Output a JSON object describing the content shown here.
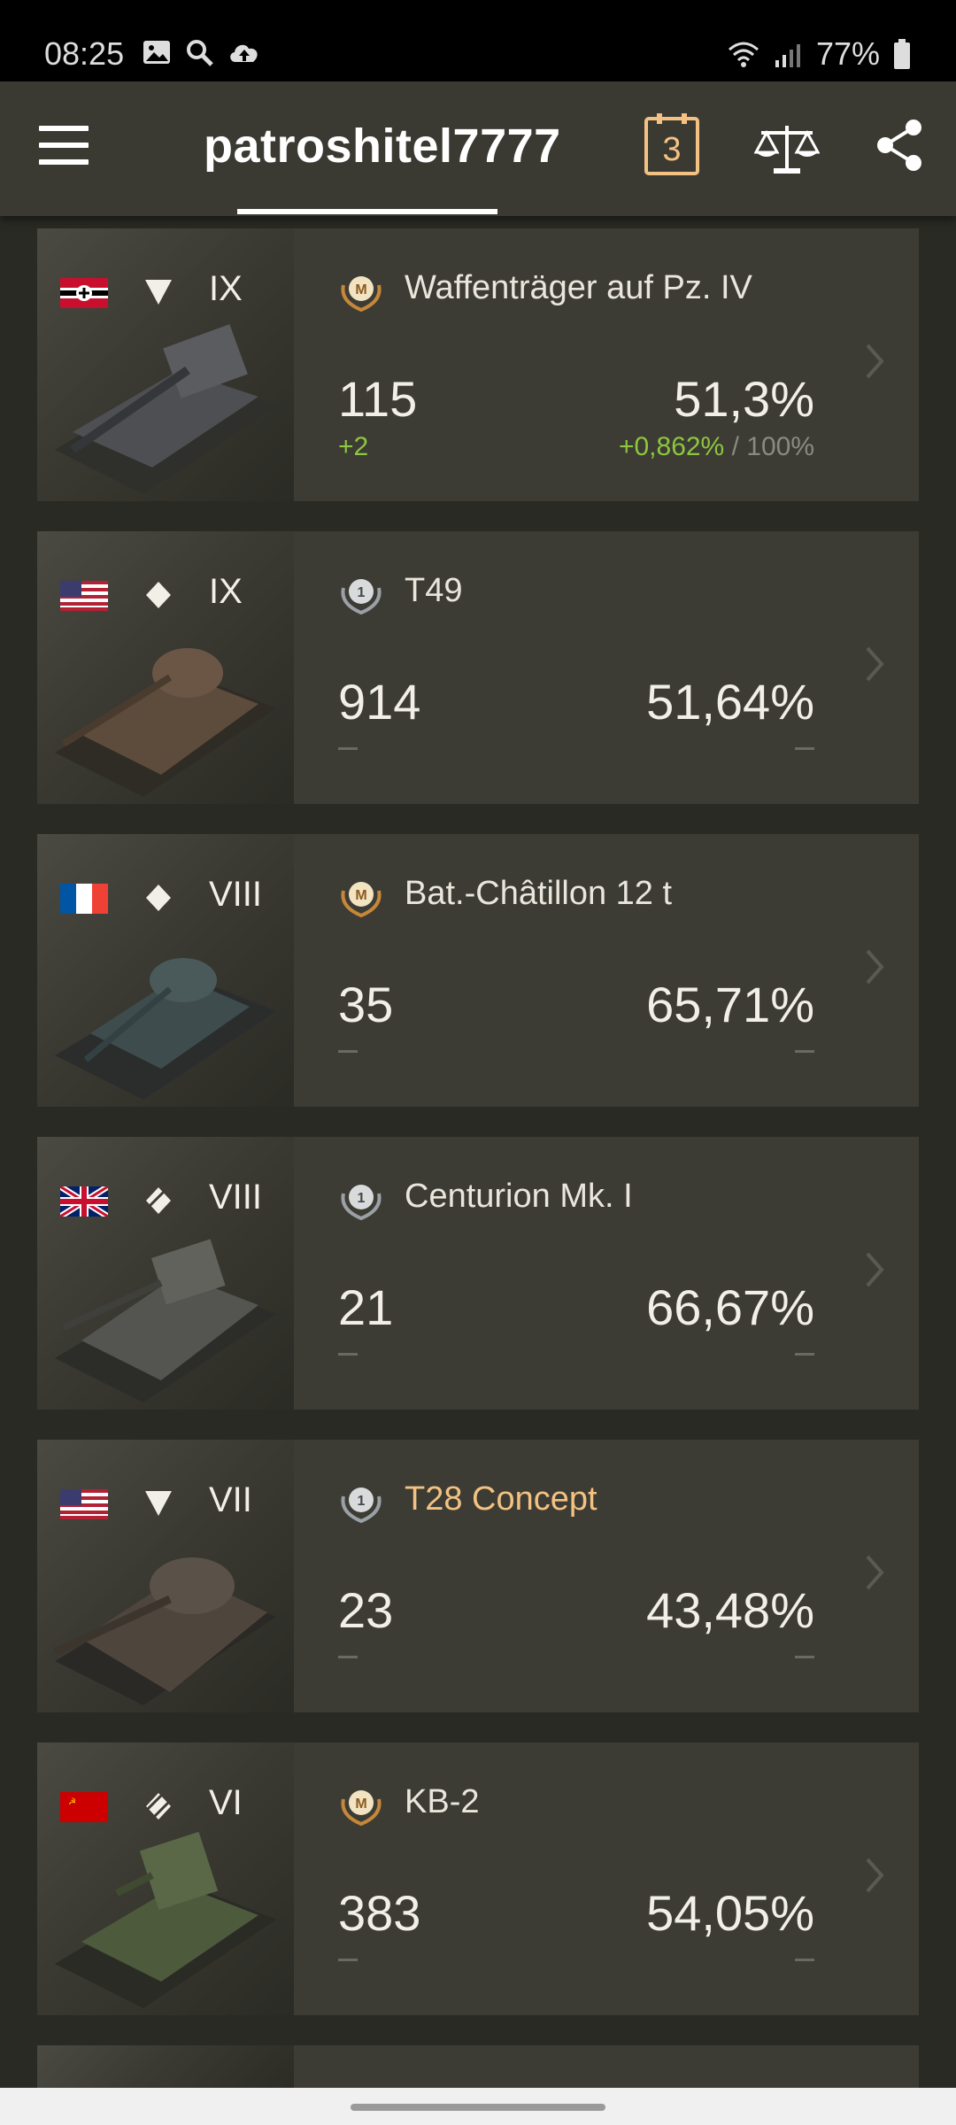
{
  "status_bar": {
    "time": "08:25",
    "battery": "77%"
  },
  "header": {
    "username": "patroshitel7777",
    "calendar_number": "3"
  },
  "tanks": [
    {
      "flag": "germany",
      "type": "tank-destroyer-icon",
      "tier": "IX",
      "mastery": "mastery-badge-icon",
      "name": "Waffenträger auf Pz. IV",
      "name_color": "#eae6dc",
      "battles": "115",
      "winrate": "51,3%",
      "battles_delta": "+2",
      "winrate_delta": "+0,862%",
      "winrate_delta_sep": " / ",
      "winrate_delta_total": "100%"
    },
    {
      "flag": "usa",
      "type": "medium-tank-icon",
      "tier": "IX",
      "mastery": "first-class-badge-icon",
      "name": "T49",
      "name_color": "#eae6dc",
      "battles": "914",
      "winrate": "51,64%"
    },
    {
      "flag": "france",
      "type": "medium-tank-icon",
      "tier": "VIII",
      "mastery": "mastery-badge-icon",
      "name": "Bat.-Châtillon 12 t",
      "name_color": "#eae6dc",
      "battles": "35",
      "winrate": "65,71%"
    },
    {
      "flag": "uk",
      "type": "medium-tank-icon",
      "tier": "VIII",
      "mastery": "first-class-badge-icon",
      "name": "Centurion Mk. I",
      "name_color": "#eae6dc",
      "battles": "21",
      "winrate": "66,67%"
    },
    {
      "flag": "usa",
      "type": "tank-destroyer-icon",
      "tier": "VII",
      "mastery": "first-class-badge-icon",
      "name": "T28 Concept",
      "name_color": "#f3c283",
      "battles": "23",
      "winrate": "43,48%"
    },
    {
      "flag": "ussr",
      "type": "heavy-tank-icon",
      "tier": "VI",
      "mastery": "mastery-badge-icon",
      "name": "KB-2",
      "name_color": "#eae6dc",
      "battles": "383",
      "winrate": "54,05%"
    }
  ]
}
